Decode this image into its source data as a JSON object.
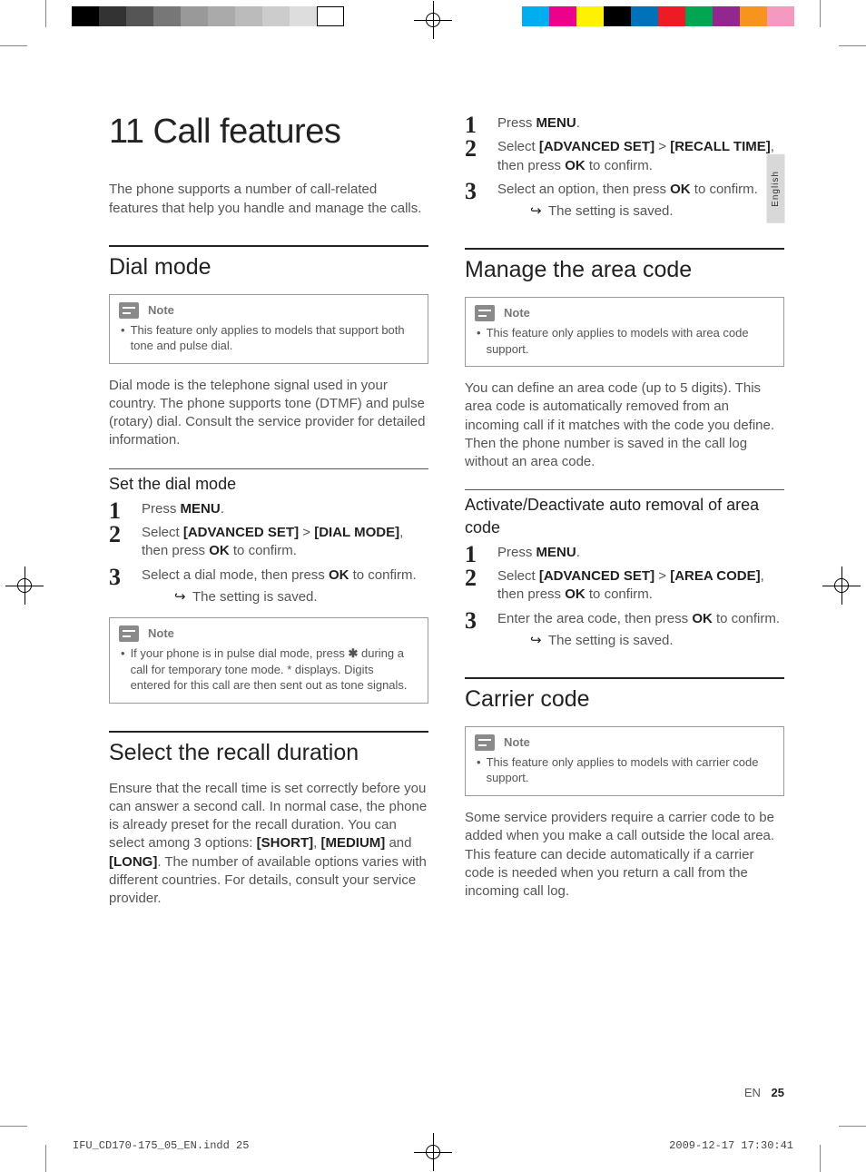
{
  "chapter_number": "11",
  "chapter_title": "Call features",
  "intro": "The phone supports a number of call-related features that help you handle and manage the calls.",
  "note_label": "Note",
  "result_saved": "The setting is saved.",
  "dial_mode": {
    "heading": "Dial mode",
    "note": "This feature only applies to models that support both tone and pulse dial.",
    "body": "Dial mode is the telephone signal used in your country. The phone supports tone (DTMF) and pulse (rotary) dial. Consult the service provider for detailed information.",
    "sub_heading": "Set the dial mode",
    "step1": "Press ",
    "step1_menu": "MENU",
    "step2_a": "Select ",
    "step2_b": "[ADVANCED SET]",
    "step2_c": " > ",
    "step2_d": "[DIAL MODE]",
    "step2_e": ", then press ",
    "step2_f": "OK",
    "step2_g": " to confirm.",
    "step3_a": "Select a dial mode, then press ",
    "step3_b": "OK",
    "step3_c": " to confirm.",
    "note2_a": "If your phone is in pulse dial mode, press ",
    "note2_star": "✱",
    "note2_b": " during a call for temporary tone mode. * displays. Digits entered for this call are then sent out as tone signals."
  },
  "recall": {
    "heading": "Select the recall duration",
    "body_a": "Ensure that the recall time is set correctly before you can answer a second call. In normal case, the phone is already preset for the recall duration. You can select among 3 options: ",
    "opt1": "[SHORT]",
    "sep1": ", ",
    "opt2": "[MEDIUM]",
    "sep2": " and ",
    "opt3": "[LONG]",
    "body_b": ". The number of available options varies with different countries. For details, consult your service provider.",
    "step1": "Press ",
    "step1_menu": "MENU",
    "step2_a": "Select ",
    "step2_b": "[ADVANCED SET]",
    "step2_c": " > ",
    "step2_d": "[RECALL TIME]",
    "step2_e": ", then press ",
    "step2_f": "OK",
    "step2_g": " to confirm.",
    "step3_a": "Select an option, then press ",
    "step3_b": "OK",
    "step3_c": " to confirm."
  },
  "area": {
    "heading": "Manage the area code",
    "note": "This feature only applies to models with area code support.",
    "body": "You can define an area code (up to 5 digits). This area code is automatically removed from an incoming call if it matches with the code you define. Then the phone number is saved in the call log without an area code.",
    "sub_heading": "Activate/Deactivate auto removal of area code",
    "step1": "Press ",
    "step1_menu": "MENU",
    "step2_a": "Select ",
    "step2_b": "[ADVANCED SET]",
    "step2_c": " > ",
    "step2_d": "[AREA CODE]",
    "step2_e": ", then press ",
    "step2_f": "OK",
    "step2_g": " to confirm.",
    "step3_a": "Enter the area code, then press ",
    "step3_b": "OK",
    "step3_c": " to confirm."
  },
  "carrier": {
    "heading": "Carrier code",
    "note": "This feature only applies to models with carrier code support.",
    "body": "Some service providers require a carrier code to be added when you make a call outside the local area. This feature can decide automatically if a carrier code is needed when you return a call from the incoming call log."
  },
  "lang_tab": "English",
  "page_lang": "EN",
  "page_number": "25",
  "slug_left": "IFU_CD170-175_05_EN.indd   25",
  "slug_right": "2009-12-17   17:30:41",
  "colorbar_left": [
    "#000",
    "#333",
    "#555",
    "#777",
    "#999",
    "#aaa",
    "#bbb",
    "#ccc",
    "#ddd",
    "#fff"
  ],
  "colorbar_right": [
    "#00aeef",
    "#ec008c",
    "#fff200",
    "#000",
    "#0072bc",
    "#ed1c24",
    "#00a651",
    "#92278f",
    "#f7941d",
    "#f49ac1"
  ]
}
